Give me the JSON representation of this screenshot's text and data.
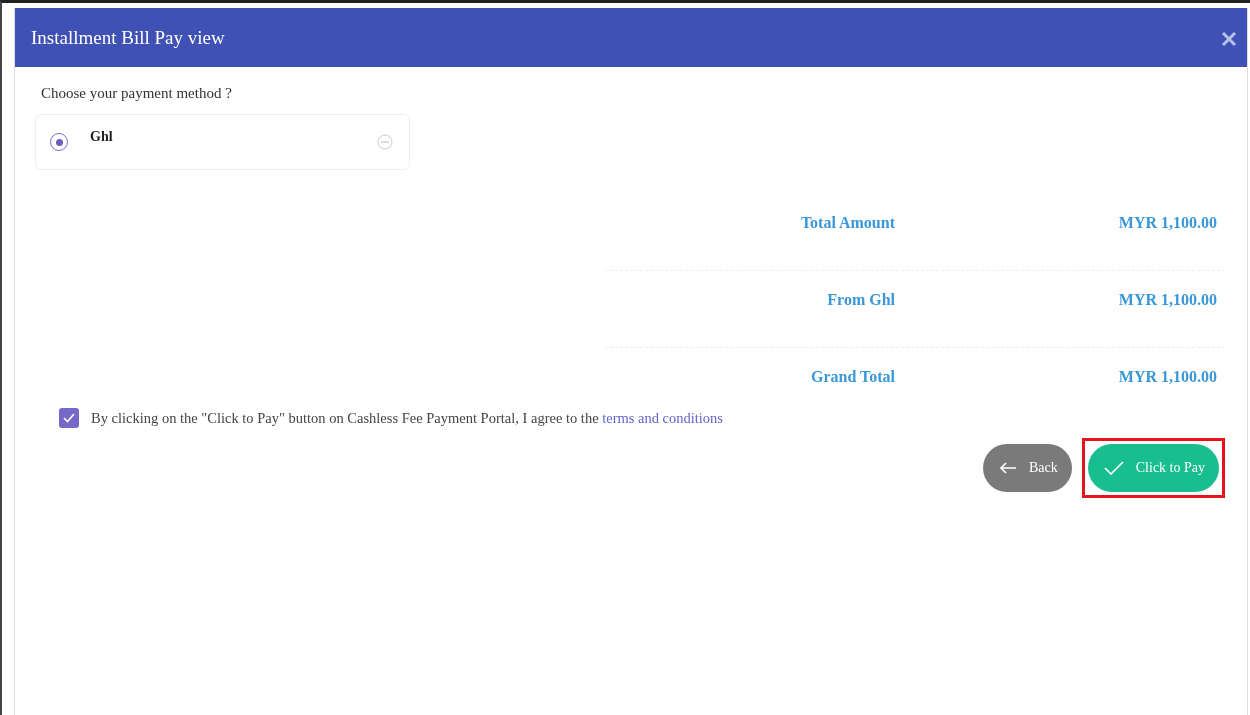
{
  "window": {
    "title": "Installment Bill Pay view"
  },
  "payment": {
    "prompt": "Choose your payment method ?",
    "methods": [
      {
        "name": "Ghl",
        "selected": true
      }
    ]
  },
  "summary": [
    {
      "label": "Total Amount",
      "value": "MYR 1,100.00"
    },
    {
      "label": "From Ghl",
      "value": "MYR 1,100.00"
    },
    {
      "label": "Grand Total",
      "value": "MYR 1,100.00"
    }
  ],
  "agreement": {
    "checked": true,
    "text": "By clicking on the \"Click to Pay\" button on Cashless Fee Payment Portal, I agree to the",
    "link": "terms and conditions"
  },
  "buttons": [
    {
      "kind": "back",
      "label": "Back",
      "highlighted": false
    },
    {
      "kind": "pay",
      "label": "Click to Pay",
      "highlighted": true
    }
  ]
}
